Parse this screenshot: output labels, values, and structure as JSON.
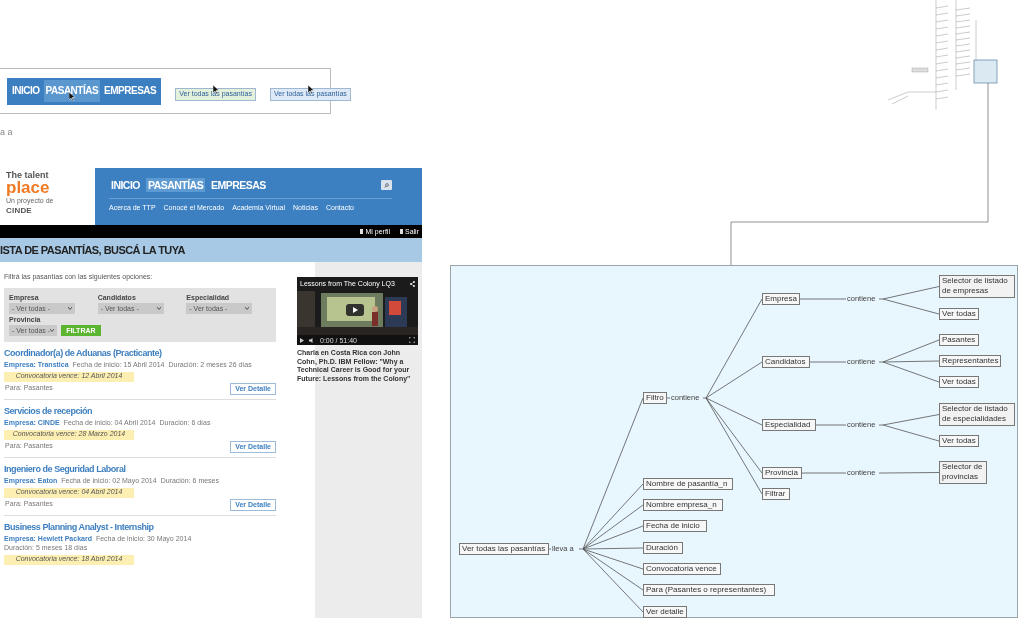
{
  "nav_strip": {
    "nav_items": [
      {
        "label": "INICIO",
        "selected": false
      },
      {
        "label": "PASANTÍAS",
        "selected": true
      },
      {
        "label": "EMPRESAS",
        "selected": false
      }
    ],
    "buttons": [
      {
        "label": "Ver todas las pasantías",
        "color": "#e3f0dc"
      },
      {
        "label": "Ver todas las pasantías",
        "color": "#dde9f6"
      }
    ]
  },
  "canvas_note": "a a",
  "site": {
    "logo": {
      "name_top": "The talent",
      "name_main": "place",
      "tagline": "Un proyecto de",
      "partner": "CINDE"
    },
    "nav_items": [
      {
        "label": "INICIO",
        "selected": false
      },
      {
        "label": "PASANTÍAS",
        "selected": true
      },
      {
        "label": "EMPRESAS",
        "selected": false
      }
    ],
    "subnav": [
      "Acerca de TTP",
      "Conocé el Mercado",
      "Academia Virtual",
      "Noticias",
      "Contacto"
    ],
    "user_links": [
      "Mi perfil",
      "Salir"
    ],
    "page_title": "ISTA DE PASANTÍAS, BUSCÁ LA TUYA",
    "filter_intro": "Filtrá las pasantías con las siguientes opciones:",
    "filters": [
      {
        "label": "Empresa",
        "value": "- Ver todas -"
      },
      {
        "label": "Candidatos",
        "value": "- Ver todas -"
      },
      {
        "label": "Especialidad",
        "value": "- Ver todas -"
      },
      {
        "label": "Provincia",
        "value": "- Ver todas -"
      }
    ],
    "filter_button": "FILTRAR",
    "listings": [
      {
        "title": "Coordinador(a) de Aduanas (Practicante)",
        "company": "Empresa: Transtica",
        "start": "Fecha de inicio: 15 Abril 2014",
        "duration": "Duración: 2 meses 26 días",
        "deadline": "Convocatoria vence: 12 Abril 2014",
        "audience": "Para: Pasantes",
        "button": "Ver Detalle"
      },
      {
        "title": "Servicios de recepción",
        "company": "Empresa: CINDE",
        "start": "Fecha de inicio: 04 Abril 2014",
        "duration": "Duración: 6 días",
        "deadline": "Convocatoria vence: 28 Marzo 2014",
        "audience": "Para: Pasantes",
        "button": "Ver Detalle"
      },
      {
        "title": "Ingeniero de Seguridad Laboral",
        "company": "Empresa: Eaton",
        "start": "Fecha de inicio: 02 Mayo 2014",
        "duration": "Duración: 6 meses",
        "deadline": "Convocatoria vence: 04 Abril 2014",
        "audience": "Para: Pasantes",
        "button": "Ver Detalle"
      },
      {
        "title": "Business Planning Analyst - Internship",
        "company": "Empresa: Hewlett Packard",
        "start": "Fecha de inicio: 30 Mayo 2014",
        "duration": "Duración: 5 meses 18 días",
        "deadline": "Convocatoria vence: 18 Abril 2014"
      }
    ],
    "video": {
      "title": "Lessons from The Colony LQ3",
      "time": "0:00 / 51:40",
      "caption": "Charla en Costa Rica con John Cohn, Ph.D. IBM Fellow: \"Why a Technical Career is Good for your Future: Lessons from the Colony\""
    }
  },
  "concept_map": {
    "root": {
      "label": "Ver todas las pasantías",
      "link": "lleva a",
      "children": [
        {
          "label": "Filtro",
          "link": "contiene",
          "children": [
            {
              "label": "Empresa",
              "link": "contiene",
              "children": [
                {
                  "label": "Selector de listado de empresas"
                },
                {
                  "label": "Ver todas"
                }
              ]
            },
            {
              "label": "Candidatos",
              "link": "contiene",
              "children": [
                {
                  "label": "Pasantes"
                },
                {
                  "label": "Representantes"
                },
                {
                  "label": "Ver todas"
                }
              ]
            },
            {
              "label": "Especialidad",
              "link": "contiene",
              "children": [
                {
                  "label": "Selector de listado de especialidades"
                },
                {
                  "label": "Ver todas"
                }
              ]
            },
            {
              "label": "Provincia",
              "link": "contiene",
              "children": [
                {
                  "label": "Selector de provincias"
                }
              ]
            },
            {
              "label": "Filtrar"
            }
          ]
        },
        {
          "label": "Nombre de pasantía_n"
        },
        {
          "label": "Nombre empresa_n"
        },
        {
          "label": "Fecha de inicio"
        },
        {
          "label": "Duración"
        },
        {
          "label": "Convocatoria vence"
        },
        {
          "label": "Para (Pasantes o representantes)"
        },
        {
          "label": "Ver detalle"
        }
      ]
    }
  }
}
